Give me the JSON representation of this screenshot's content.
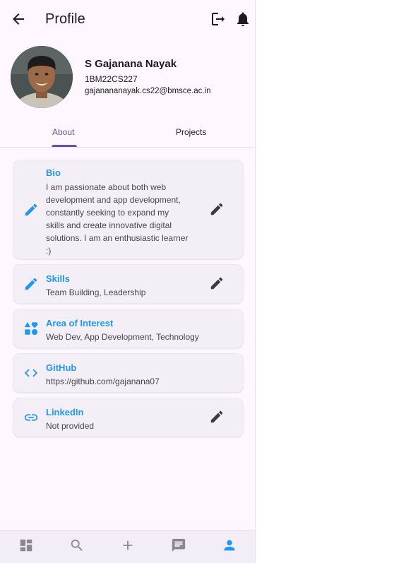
{
  "appbar": {
    "title": "Profile"
  },
  "profile": {
    "name": "S Gajanana Nayak",
    "id": "1BM22CS227",
    "email": "gajanananayak.cs22@bmsce.ac.in"
  },
  "tabs": [
    {
      "label": "About",
      "selected": true
    },
    {
      "label": "Projects",
      "selected": false
    }
  ],
  "cards": {
    "bio": {
      "title": "Bio",
      "lines": [
        "I am passionate about both web",
        "development and app development,",
        "constantly seeking to expand my",
        "skills and create innovative digital",
        "solutions. I am an enthusiastic learner",
        ":)"
      ]
    },
    "skills": {
      "title": "Skills",
      "value": "Team Building, Leadership"
    },
    "interest": {
      "title": "Area of Interest",
      "value": "Web Dev, App Development, Technology"
    },
    "github": {
      "title": "GitHub",
      "value": "https://github.com/gajanana07"
    },
    "linkedin": {
      "title": "LinkedIn",
      "value": "Not provided"
    }
  },
  "icons": {
    "back": "arrow-back-icon",
    "logout": "logout-icon",
    "notifications": "bell-icon",
    "bio": "pencil-icon",
    "skills": "pencil-icon",
    "interest": "category-icon",
    "github": "code-icon",
    "linkedin": "link-icon",
    "edit": "edit-icon",
    "nav": [
      "dashboard-icon",
      "search-icon",
      "add-icon",
      "chat-icon",
      "person-icon"
    ]
  },
  "colors": {
    "accent": "#2196f3",
    "tab_selected": "#6750a4",
    "background": "#fef7ff",
    "card": "#f4eff6"
  }
}
